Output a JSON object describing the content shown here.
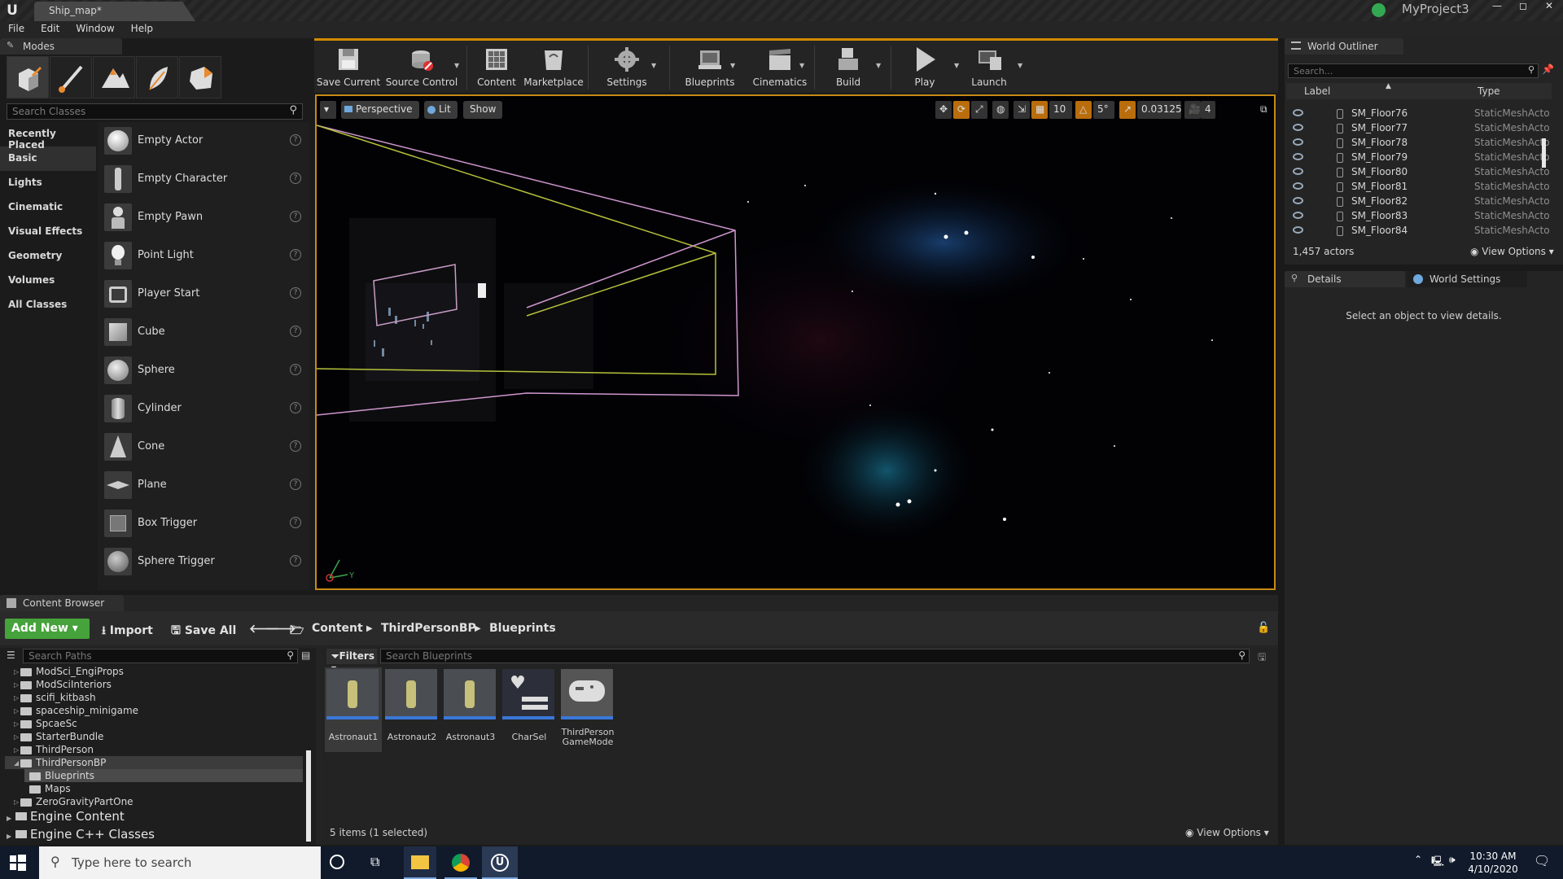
{
  "window": {
    "tab_title": "Ship_map*",
    "project_name": "MyProject3",
    "min_label": "—",
    "max_label": "◻",
    "close_label": "✕"
  },
  "menu": [
    "File",
    "Edit",
    "Window",
    "Help"
  ],
  "modes": {
    "tab_label": "Modes",
    "search_placeholder": "Search Classes",
    "categories": [
      "Recently Placed",
      "Basic",
      "Lights",
      "Cinematic",
      "Visual Effects",
      "Geometry",
      "Volumes",
      "All Classes"
    ],
    "classes": [
      "Empty Actor",
      "Empty Character",
      "Empty Pawn",
      "Point Light",
      "Player Start",
      "Cube",
      "Sphere",
      "Cylinder",
      "Cone",
      "Plane",
      "Box Trigger",
      "Sphere Trigger"
    ],
    "help_glyph": "?"
  },
  "toolbar": {
    "save_current": "Save Current",
    "source_control": "Source Control",
    "content": "Content",
    "marketplace": "Marketplace",
    "settings": "Settings",
    "blueprints": "Blueprints",
    "cinematics": "Cinematics",
    "build": "Build",
    "play": "Play",
    "launch": "Launch"
  },
  "viewport": {
    "dropdown": "▾",
    "perspective": "Perspective",
    "lit": "Lit",
    "show": "Show",
    "grid_snap": "10",
    "rotation_snap": "5°",
    "scale_snap": "0.03125",
    "camera_speed": "4",
    "axis_y": "Y"
  },
  "outliner": {
    "tab_label": "World Outliner",
    "search_placeholder": "Search...",
    "col_label": "Label",
    "col_type": "Type",
    "rows": [
      {
        "label": "SM_Floor76",
        "type": "StaticMeshActo"
      },
      {
        "label": "SM_Floor77",
        "type": "StaticMeshActo"
      },
      {
        "label": "SM_Floor78",
        "type": "StaticMeshActo"
      },
      {
        "label": "SM_Floor79",
        "type": "StaticMeshActo"
      },
      {
        "label": "SM_Floor80",
        "type": "StaticMeshActo"
      },
      {
        "label": "SM_Floor81",
        "type": "StaticMeshActo"
      },
      {
        "label": "SM_Floor82",
        "type": "StaticMeshActo"
      },
      {
        "label": "SM_Floor83",
        "type": "StaticMeshActo"
      },
      {
        "label": "SM_Floor84",
        "type": "StaticMeshActo"
      }
    ],
    "actor_count": "1,457 actors",
    "view_options": "View Options"
  },
  "details": {
    "tab_details": "Details",
    "tab_world_settings": "World Settings",
    "empty_message": "Select an object to view details."
  },
  "content_browser": {
    "tab_label": "Content Browser",
    "add_new": "Add New",
    "import": "Import",
    "save_all": "Save All",
    "breadcrumbs": [
      "Content",
      "ThirdPersonBP",
      "Blueprints"
    ],
    "search_paths_placeholder": "Search Paths",
    "filters": "Filters",
    "search_blueprints_placeholder": "Search Blueprints",
    "folders": [
      "ModSci_EngiProps",
      "ModSciInteriors",
      "scifi_kitbash",
      "spaceship_minigame",
      "SpcaeSc",
      "StarterBundle",
      "ThirdPerson",
      "ThirdPersonBP",
      "Blueprints",
      "Maps",
      "ZeroGravityPartOne"
    ],
    "engine_content": "Engine Content",
    "engine_cpp": "Engine C++ Classes",
    "assets": [
      {
        "label": "Astronaut1"
      },
      {
        "label": "Astronaut2"
      },
      {
        "label": "Astronaut3"
      },
      {
        "label": "CharSel"
      },
      {
        "label": "ThirdPerson GameMode"
      }
    ],
    "status": "5 items (1 selected)",
    "view_options": "View Options"
  },
  "taskbar": {
    "search_placeholder": "Type here to search",
    "time": "10:30 AM",
    "date": "4/10/2020"
  }
}
